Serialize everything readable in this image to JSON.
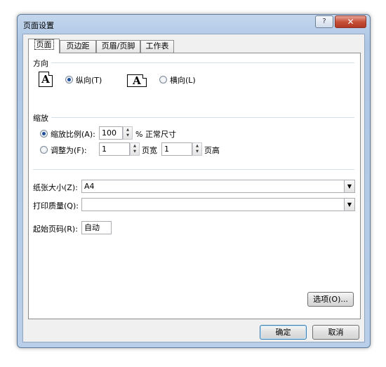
{
  "window": {
    "title": "页面设置",
    "help_label": "?",
    "close_label": "✕"
  },
  "tabs": [
    {
      "label": "页面",
      "active": true
    },
    {
      "label": "页边距",
      "active": false
    },
    {
      "label": "页眉/页脚",
      "active": false
    },
    {
      "label": "工作表",
      "active": false
    }
  ],
  "orientation": {
    "section_label": "方向",
    "icon_glyph": "A",
    "portrait_label": "纵向(T)",
    "landscape_label": "横向(L)",
    "selected": "portrait"
  },
  "scaling": {
    "section_label": "缩放",
    "adjust_to_label": "缩放比例(A):",
    "adjust_to_value": "100",
    "adjust_to_suffix": "% 正常尺寸",
    "fit_to_label": "调整为(F):",
    "pages_wide_value": "1",
    "pages_wide_suffix": "页宽",
    "pages_tall_value": "1",
    "pages_tall_suffix": "页高",
    "selected": "adjust"
  },
  "paper_size": {
    "label": "纸张大小(Z):",
    "value": "A4"
  },
  "print_quality": {
    "label": "打印质量(Q):",
    "value": ""
  },
  "first_page_number": {
    "label": "起始页码(R):",
    "value": "自动"
  },
  "buttons": {
    "options": "选项(O)...",
    "ok": "确定",
    "cancel": "取消"
  }
}
